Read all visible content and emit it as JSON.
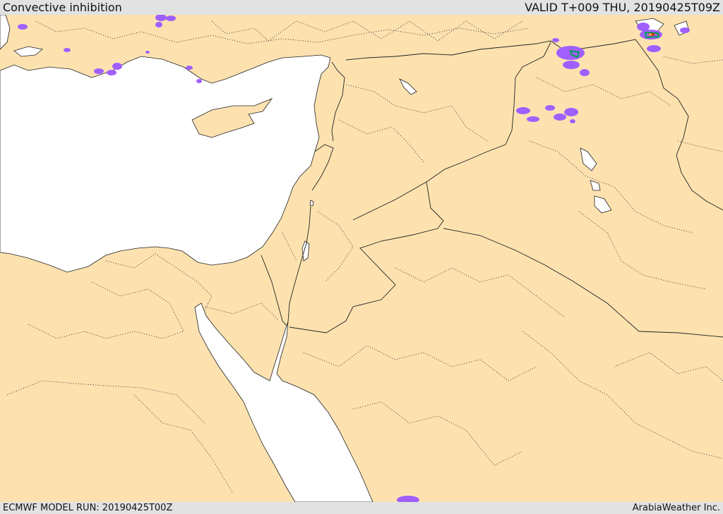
{
  "header": {
    "title": "Convective inhibition",
    "valid": "VALID T+009 THU, 20190425T09Z"
  },
  "footer": {
    "model_run": "ECMWF MODEL RUN: 20190425T00Z",
    "credit": "ArabiaWeather Inc."
  },
  "colors": {
    "land": "#fde2b0",
    "water": "#ffffff",
    "cin_low": "#a060ff",
    "cin_mid": "#00a050",
    "cin_high": "#e03020"
  }
}
